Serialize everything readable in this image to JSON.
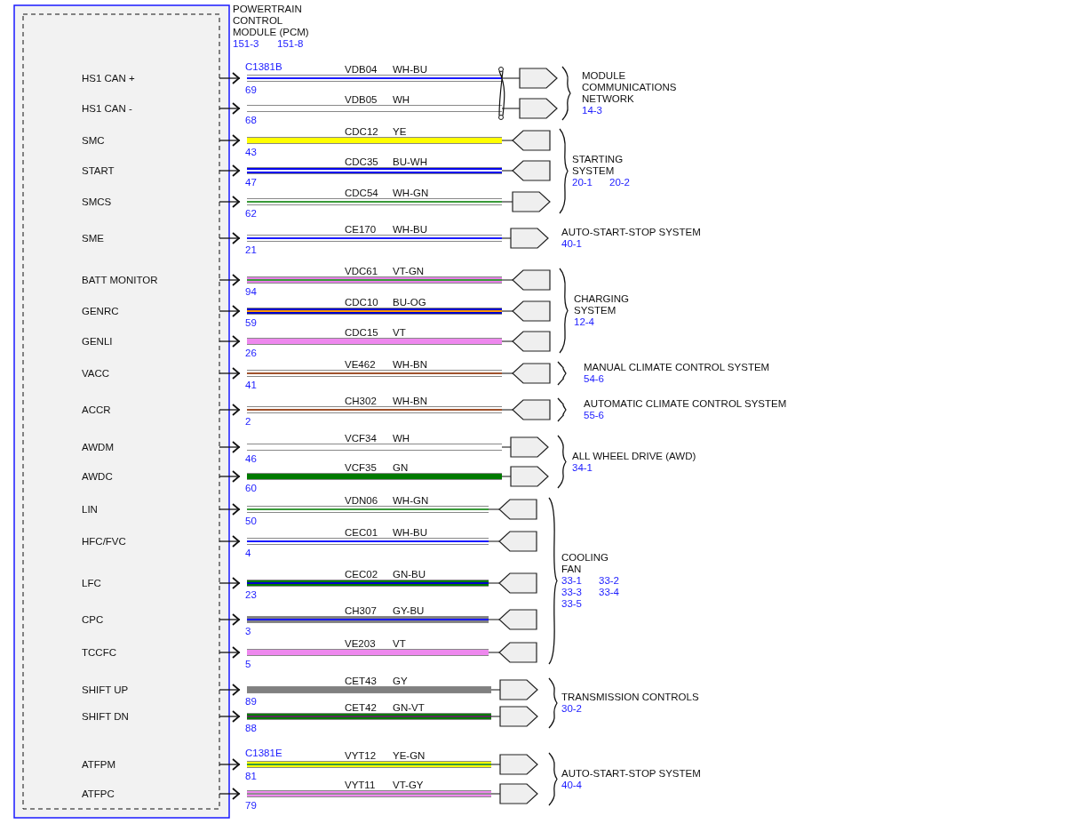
{
  "module": {
    "name_lines": [
      "POWERTRAIN",
      "CONTROL",
      "MODULE (PCM)"
    ],
    "refs": [
      "151-3",
      "151-8"
    ]
  },
  "destinations": [
    {
      "name_lines": [
        "MODULE",
        "COMMUNICATIONS",
        "NETWORK"
      ],
      "refs": [
        "14-3"
      ],
      "twisted": true,
      "wires": [
        {
          "signal": "HS1 CAN +",
          "connector": "C1381B",
          "pin": "69",
          "circuit": "VDB04",
          "code": "WH-BU",
          "color": "#ffffff",
          "stripe": {
            "color": "#1a1aff"
          },
          "kind": "tip_right"
        },
        {
          "signal": "HS1 CAN -",
          "pin": "68",
          "circuit": "VDB05",
          "code": "WH",
          "color": "#ffffff",
          "kind": "tip_right"
        }
      ]
    },
    {
      "name_lines": [
        "STARTING",
        "SYSTEM"
      ],
      "refs": [
        "20-1",
        "20-2"
      ],
      "twisted": false,
      "wires": [
        {
          "signal": "SMC",
          "pin": "43",
          "circuit": "CDC12",
          "code": "YE",
          "color": "#ffff00",
          "kind": "tip_left"
        },
        {
          "signal": "START",
          "pin": "47",
          "circuit": "CDC35",
          "code": "BU-WH",
          "color": "#0000ee",
          "stripe": {
            "color": "#ffffff"
          },
          "kind": "tip_left"
        },
        {
          "signal": "SMCS",
          "pin": "62",
          "circuit": "CDC54",
          "code": "WH-GN",
          "color": "#ffffff",
          "stripe": {
            "color": "#3a9a3a"
          },
          "kind": "tip_right"
        }
      ]
    },
    {
      "name_lines": [
        "AUTO-START-STOP SYSTEM"
      ],
      "refs": [
        "40-1"
      ],
      "twisted": false,
      "wires": [
        {
          "signal": "SME",
          "pin": "21",
          "circuit": "CE170",
          "code": "WH-BU",
          "color": "#ffffff",
          "stripe": {
            "color": "#1a1aff"
          },
          "kind": "tip_right"
        }
      ]
    },
    {
      "name_lines": [
        "CHARGING",
        "SYSTEM"
      ],
      "refs": [
        "12-4"
      ],
      "twisted": false,
      "wires": [
        {
          "signal": "BATT MONITOR",
          "pin": "94",
          "circuit": "VDC61",
          "code": "VT-GN",
          "color": "#e680e6",
          "stripe": {
            "color": "#3a9a3a"
          },
          "kind": "tip_left"
        },
        {
          "signal": "GENRC",
          "pin": "59",
          "circuit": "CDC10",
          "code": "BU-OG",
          "color": "#0000cc",
          "stripe": {
            "color": "#ff9900"
          },
          "kind": "tip_left"
        },
        {
          "signal": "GENLI",
          "pin": "26",
          "circuit": "CDC15",
          "code": "VT",
          "color": "#ee88ee",
          "kind": "tip_left"
        }
      ]
    },
    {
      "name_lines": [
        "MANUAL CLIMATE CONTROL SYSTEM"
      ],
      "refs": [
        "54-6"
      ],
      "twisted": false,
      "wires": [
        {
          "signal": "VACC",
          "pin": "41",
          "circuit": "VE462",
          "code": "WH-BN",
          "color": "#ffffff",
          "stripe": {
            "color": "#a0522d"
          },
          "kind": "tip_left"
        }
      ]
    },
    {
      "name_lines": [
        "AUTOMATIC CLIMATE CONTROL SYSTEM"
      ],
      "refs": [
        "55-6"
      ],
      "twisted": false,
      "wires": [
        {
          "signal": "ACCR",
          "pin": "2",
          "circuit": "CH302",
          "code": "WH-BN",
          "color": "#ffffff",
          "stripe": {
            "color": "#a0522d"
          },
          "kind": "tip_left"
        }
      ]
    },
    {
      "name_lines": [
        "ALL WHEEL DRIVE (AWD)"
      ],
      "refs": [
        "34-1"
      ],
      "twisted": false,
      "wires": [
        {
          "signal": "AWDM",
          "pin": "46",
          "circuit": "VCF34",
          "code": "WH",
          "color": "#ffffff",
          "kind": "tip_right"
        },
        {
          "signal": "AWDC",
          "pin": "60",
          "circuit": "VCF35",
          "code": "GN",
          "color": "#007a00",
          "kind": "tip_right"
        }
      ]
    },
    {
      "name_lines": [
        "COOLING",
        "FAN"
      ],
      "refs": [
        "33-1",
        "33-2",
        "33-3",
        "33-4",
        "33-5"
      ],
      "twisted": false,
      "wires": [
        {
          "signal": "LIN",
          "pin": "50",
          "circuit": "VDN06",
          "code": "WH-GN",
          "color": "#ffffff",
          "stripe": {
            "color": "#3a9a3a"
          },
          "kind": "tip_left"
        },
        {
          "signal": "HFC/FVC",
          "pin": "4",
          "circuit": "CEC01",
          "code": "WH-BU",
          "color": "#ffffff",
          "stripe": {
            "color": "#1a1aff"
          },
          "kind": "tip_left"
        },
        {
          "signal": "LFC",
          "pin": "23",
          "circuit": "CEC02",
          "code": "GN-BU",
          "color": "#007a00",
          "stripe": {
            "color": "#0000cc"
          },
          "kind": "tip_left"
        },
        {
          "signal": "CPC",
          "pin": "3",
          "circuit": "CH307",
          "code": "GY-BU",
          "color": "#808080",
          "stripe": {
            "color": "#1a1aff"
          },
          "kind": "tip_left"
        },
        {
          "signal": "TCCFC",
          "pin": "5",
          "circuit": "VE203",
          "code": "VT",
          "color": "#ee88ee",
          "kind": "tip_left"
        }
      ]
    },
    {
      "name_lines": [
        "TRANSMISSION CONTROLS"
      ],
      "refs": [
        "30-2"
      ],
      "twisted": false,
      "wires": [
        {
          "signal": "SHIFT UP",
          "pin": "89",
          "circuit": "CET43",
          "code": "GY",
          "color": "#808080",
          "kind": "tip_right"
        },
        {
          "signal": "SHIFT DN",
          "pin": "88",
          "circuit": "CET42",
          "code": "GN-VT",
          "color": "#007a00",
          "stripe": {
            "color": "#5a2a5a"
          },
          "kind": "tip_right"
        }
      ]
    },
    {
      "name_lines": [
        "AUTO-START-STOP SYSTEM"
      ],
      "refs": [
        "40-4"
      ],
      "twisted": false,
      "wires": [
        {
          "signal": "ATFPM",
          "connector": "C1381E",
          "pin": "81",
          "circuit": "VYT12",
          "code": "YE-GN",
          "color": "#ffff00",
          "stripe": {
            "color": "#3a9a3a"
          },
          "kind": "tip_right"
        },
        {
          "signal": "ATFPC",
          "pin": "79",
          "circuit": "VYT11",
          "code": "VT-GY",
          "color": "#ee88ee",
          "stripe": {
            "color": "#909090"
          },
          "kind": "tip_right"
        }
      ]
    }
  ]
}
